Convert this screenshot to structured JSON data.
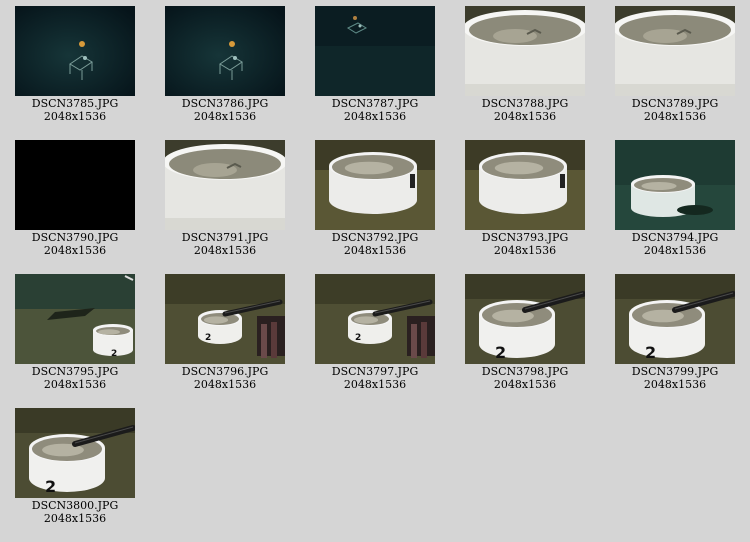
{
  "gallery": {
    "items": [
      {
        "filename": "DSCN3785.JPG",
        "dimensions": "2048x1536",
        "scene": "seafloor-dark-lander"
      },
      {
        "filename": "DSCN3786.JPG",
        "dimensions": "2048x1536",
        "scene": "seafloor-dark-lander"
      },
      {
        "filename": "DSCN3787.JPG",
        "dimensions": "2048x1536",
        "scene": "seafloor-dark-lander-faint"
      },
      {
        "filename": "DSCN3788.JPG",
        "dimensions": "2048x1536",
        "scene": "white-bucket-closeup"
      },
      {
        "filename": "DSCN3789.JPG",
        "dimensions": "2048x1536",
        "scene": "white-bucket-closeup"
      },
      {
        "filename": "DSCN3790.JPG",
        "dimensions": "2048x1536",
        "scene": "black-frame"
      },
      {
        "filename": "DSCN3791.JPG",
        "dimensions": "2048x1536",
        "scene": "white-bucket-closeup"
      },
      {
        "filename": "DSCN3792.JPG",
        "dimensions": "2048x1536",
        "scene": "bucket-on-sediment"
      },
      {
        "filename": "DSCN3793.JPG",
        "dimensions": "2048x1536",
        "scene": "bucket-on-sediment"
      },
      {
        "filename": "DSCN3794.JPG",
        "dimensions": "2048x1536",
        "scene": "bucket-distant-green"
      },
      {
        "filename": "DSCN3795.JPG",
        "dimensions": "2048x1536",
        "scene": "bucket-with-shadow"
      },
      {
        "filename": "DSCN3796.JPG",
        "dimensions": "2048x1536",
        "scene": "bucket-with-robot-arm"
      },
      {
        "filename": "DSCN3797.JPG",
        "dimensions": "2048x1536",
        "scene": "bucket-with-robot-arm"
      },
      {
        "filename": "DSCN3798.JPG",
        "dimensions": "2048x1536",
        "scene": "bucket-arm-closeup"
      },
      {
        "filename": "DSCN3799.JPG",
        "dimensions": "2048x1536",
        "scene": "bucket-arm-closeup"
      },
      {
        "filename": "DSCN3800.JPG",
        "dimensions": "2048x1536",
        "scene": "bucket-arm-closeup"
      }
    ],
    "bucket_label": "2",
    "colors": {
      "page_background": "#d5d5d5",
      "caption_text": "#000000",
      "deep_water": "#0f2a2d",
      "sediment": "#5c5a36",
      "bucket_white": "#eeeeee"
    }
  }
}
